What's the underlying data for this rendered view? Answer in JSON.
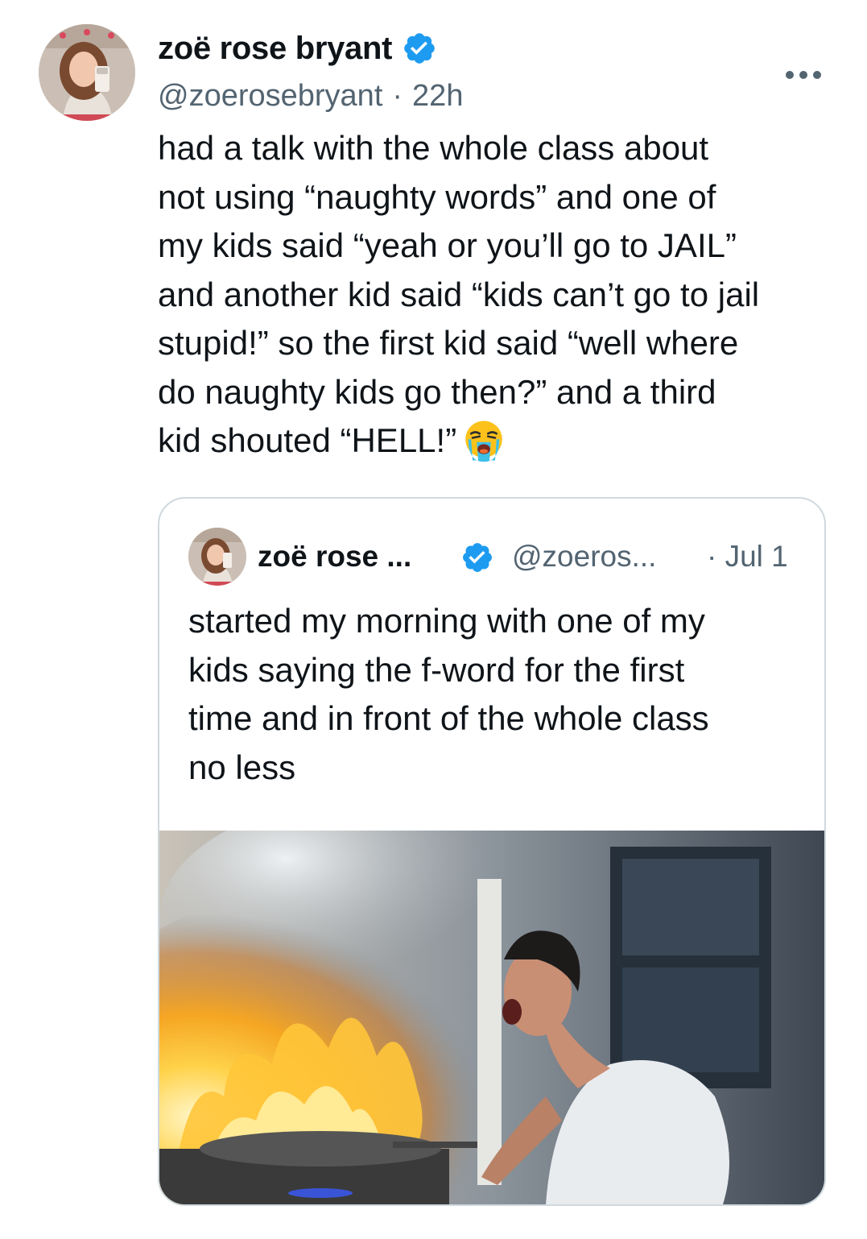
{
  "tweet": {
    "display_name": "zoë rose bryant",
    "handle": "@zoerosebryant",
    "separator": "·",
    "time": "22h",
    "text_lines": [
      "had a talk with the whole class about",
      "not using “naughty words” and one of",
      "my kids said “yeah or you’ll go to JAIL”",
      "and another kid said “kids can’t go to jail",
      "stupid!” so the first kid said “well where",
      "do naughty kids go then?” and a third",
      "kid shouted “HELL!”"
    ],
    "emoji": "loudly-crying-face"
  },
  "quoted_tweet": {
    "display_name": "zoë rose ...",
    "handle": "@zoeros...",
    "date": "· Jul 1",
    "text_lines": [
      "started my morning with one of my",
      "kids saying the f-word for the first",
      "time and in front of the whole class",
      "no less"
    ],
    "media": "photo-man-screaming-at-kitchen-fire"
  },
  "colors": {
    "text_primary": "#0f1419",
    "text_secondary": "#536471",
    "verified_blue": "#1d9bf0",
    "card_border": "#cfd9de"
  },
  "icons": {
    "verified": "verified-badge-icon",
    "more": "more-options-icon"
  }
}
